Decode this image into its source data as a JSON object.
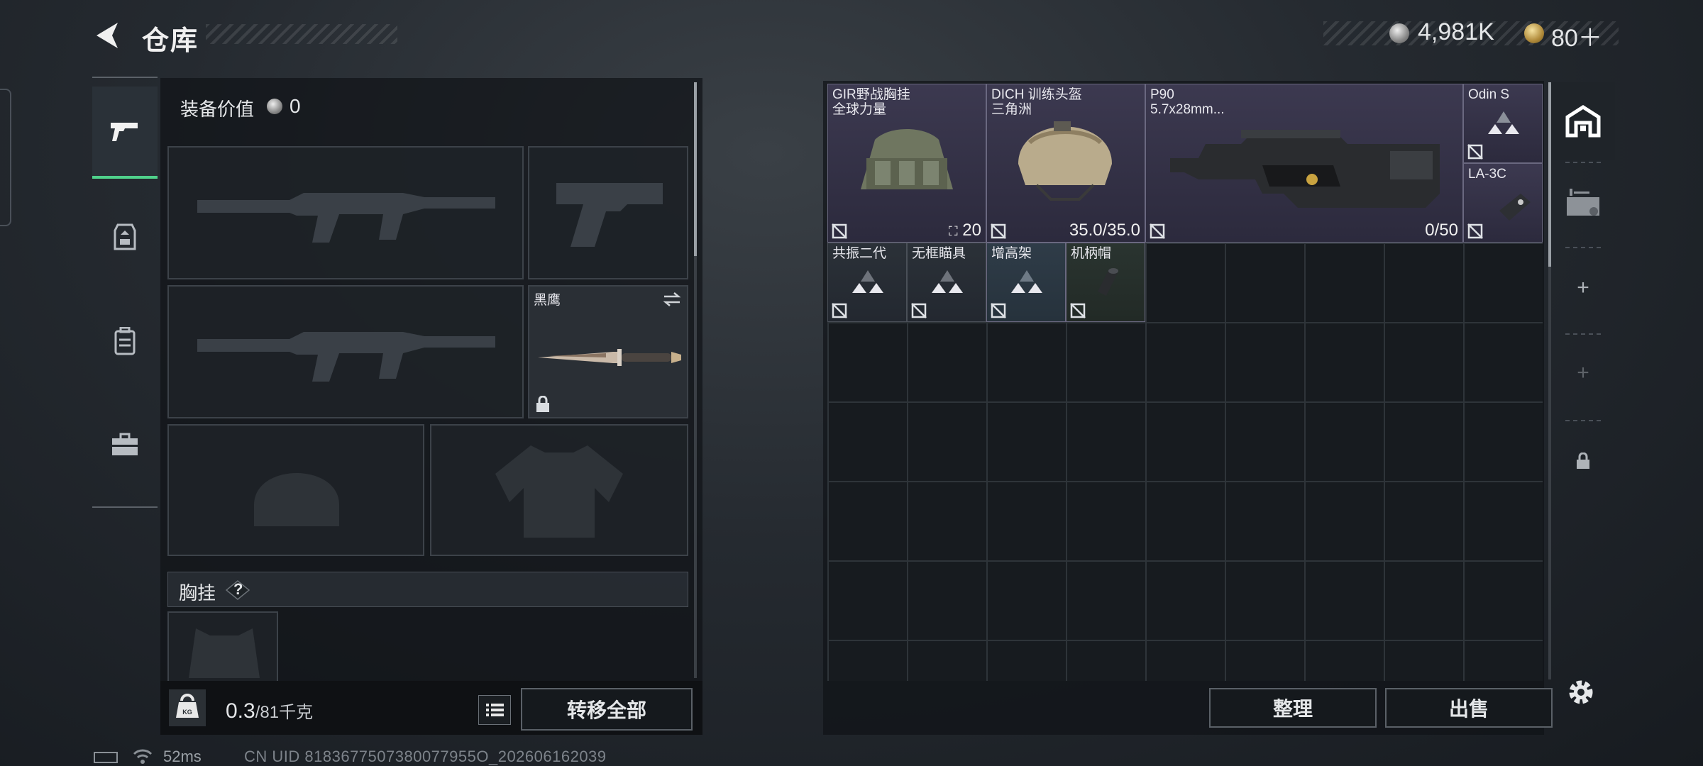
{
  "header": {
    "title": "仓库"
  },
  "currency": {
    "silver": "4,981K",
    "gold": "80＋"
  },
  "loadout": {
    "equip_value_label": "装备价值",
    "equip_value": "0",
    "melee_name": "黑鹰",
    "chest_label": "胸挂",
    "chest_help": "?",
    "weight_current": "0.3",
    "weight_max": "/81千克",
    "transfer_all": "转移全部"
  },
  "warehouse": {
    "items": [
      {
        "name_line1": "GIR野战胸挂",
        "name_line2": "全球力量",
        "stat": "20",
        "rarity": "purple"
      },
      {
        "name_line1": "DICH 训练头盔",
        "name_line2": "三角洲",
        "stat": "35.0/35.0",
        "rarity": "purple"
      },
      {
        "name_line1": "P90",
        "name_line2": "5.7x28mm...",
        "stat": "0/50",
        "rarity": "purple"
      },
      {
        "name_line1": "Odin S",
        "name_line2": "",
        "stat": "",
        "rarity": "purple"
      },
      {
        "name_line1": "LA-3C",
        "name_line2": "",
        "stat": "",
        "rarity": "purple"
      },
      {
        "name_line1": "共振二代",
        "name_line2": "",
        "stat": "",
        "rarity": "gray"
      },
      {
        "name_line1": "无框瞄具",
        "name_line2": "",
        "stat": "",
        "rarity": "gray"
      },
      {
        "name_line1": "增高架",
        "name_line2": "",
        "stat": "",
        "rarity": "blue"
      },
      {
        "name_line1": "机柄帽",
        "name_line2": "",
        "stat": "",
        "rarity": "green"
      }
    ],
    "sort_label": "整理",
    "sell_label": "出售"
  },
  "footer": {
    "ping": "52ms",
    "uid": "CN UID 8183677507380077955O_202606162039"
  },
  "colors": {
    "accent_green": "#4fd18b",
    "rarity_purple": "#3c3950",
    "rarity_blue": "#2f3c48",
    "rarity_green": "#2a3430"
  }
}
